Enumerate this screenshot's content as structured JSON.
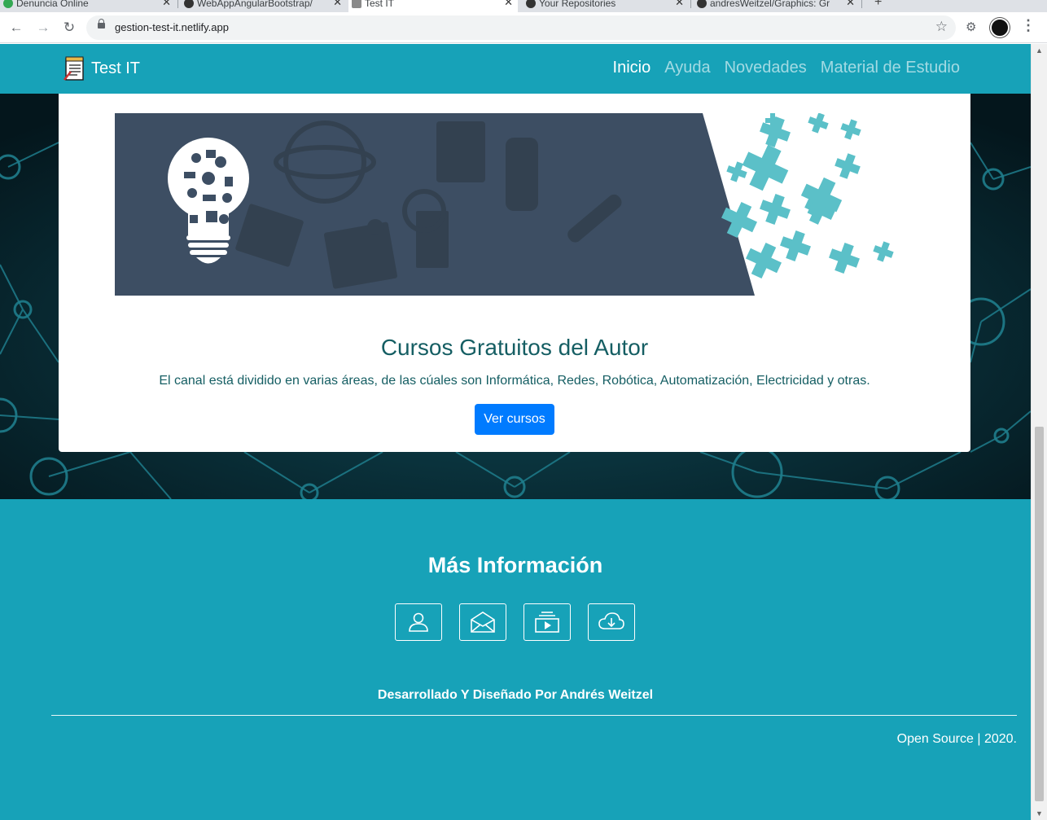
{
  "browser": {
    "tabs": [
      {
        "title": "Denuncia Online"
      },
      {
        "title": "WebAppAngularBootstrap/"
      },
      {
        "title": "Test IT"
      },
      {
        "title": "Your Repositories"
      },
      {
        "title": "andresWeitzel/Graphics: Gr"
      }
    ],
    "url": "gestion-test-it.netlify.app"
  },
  "navbar": {
    "brand": "Test IT",
    "links": [
      {
        "label": "Inicio"
      },
      {
        "label": "Ayuda"
      },
      {
        "label": "Novedades"
      },
      {
        "label": "Material de Estudio"
      }
    ]
  },
  "card": {
    "title": "Cursos Gratuitos del Autor",
    "text": "El canal está dividido en varias áreas, de las cúales son Informática, Redes, Robótica, Automatización, Electricidad y otras.",
    "button": "Ver cursos"
  },
  "footer": {
    "title": "Más Información",
    "icons": [
      "user-icon",
      "envelope-icon",
      "video-icon",
      "cloud-download-icon"
    ],
    "credit": "Desarrollado Y Diseñado Por Andrés Weitzel",
    "copyright": "Open Source | 2020."
  },
  "colors": {
    "navbar": "#17a2b8",
    "primary_button": "#007bff",
    "banner": "#3d4e63",
    "accent_cross": "#5bc0c8",
    "title_text": "#155e63"
  }
}
